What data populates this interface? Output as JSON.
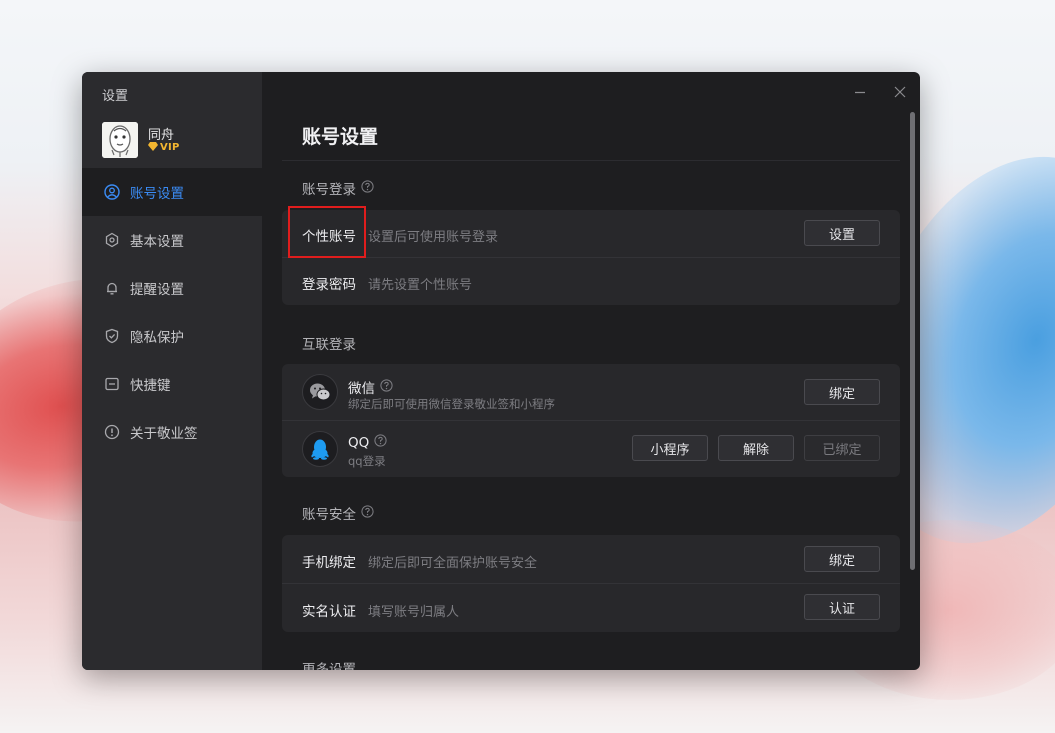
{
  "window": {
    "title": "设置"
  },
  "profile": {
    "name": "同舟",
    "badge": "VIP"
  },
  "sidebar": {
    "items": [
      {
        "label": "账号设置",
        "icon": "user-circle-icon",
        "active": true
      },
      {
        "label": "基本设置",
        "icon": "hexagon-gear-icon"
      },
      {
        "label": "提醒设置",
        "icon": "bell-icon"
      },
      {
        "label": "隐私保护",
        "icon": "shield-check-icon"
      },
      {
        "label": "快捷键",
        "icon": "keyboard-icon"
      },
      {
        "label": "关于敬业签",
        "icon": "info-circle-icon"
      }
    ]
  },
  "main": {
    "title": "账号设置",
    "sections": {
      "account_login": {
        "label": "账号登录",
        "rows": [
          {
            "title": "个性账号",
            "desc": "设置后可使用账号登录",
            "button": "设置"
          },
          {
            "title": "登录密码",
            "desc": "请先设置个性账号"
          }
        ]
      },
      "linked_login": {
        "label": "互联登录",
        "wechat": {
          "name": "微信",
          "desc": "绑定后即可使用微信登录敬业签和小程序",
          "button": "绑定",
          "icon": "wechat-icon"
        },
        "qq": {
          "name": "QQ",
          "desc": "qq登录",
          "buttons": [
            "小程序",
            "解除",
            "已绑定"
          ],
          "icon": "qq-penguin-icon"
        }
      },
      "account_security": {
        "label": "账号安全",
        "rows": [
          {
            "title": "手机绑定",
            "desc": "绑定后即可全面保护账号安全",
            "button": "绑定"
          },
          {
            "title": "实名认证",
            "desc": "填写账号归属人",
            "button": "认证"
          }
        ]
      },
      "more": {
        "label": "更多设置"
      }
    }
  },
  "colors": {
    "accent": "#3b8cf5",
    "vip": "#f3b630",
    "highlight": "#e01d1d",
    "qq": "#1e9bf0"
  }
}
